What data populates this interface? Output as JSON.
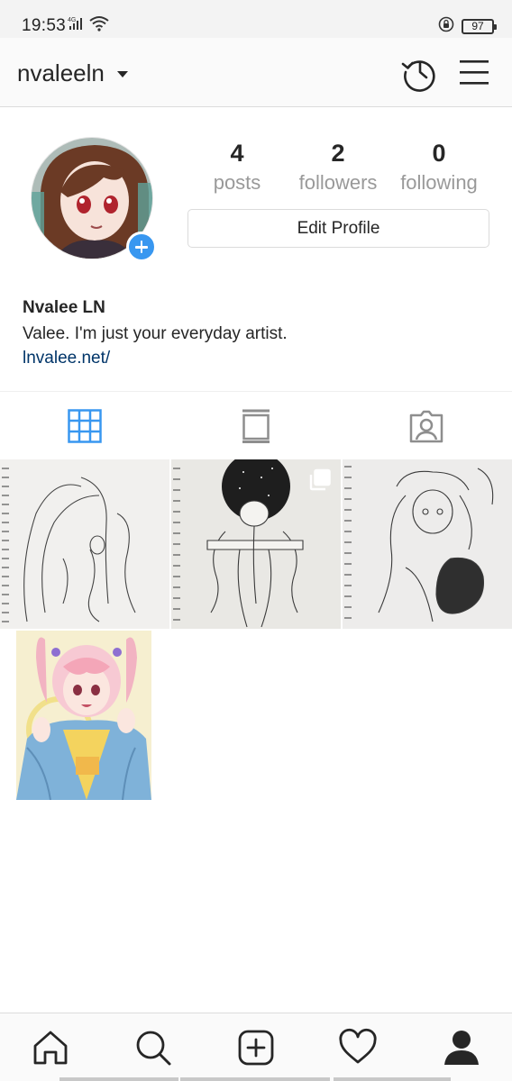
{
  "status_bar": {
    "time": "19:53",
    "network": "4G",
    "battery": "97"
  },
  "header": {
    "username": "nvaleeln",
    "icons": [
      "chevron-down-icon",
      "history-icon",
      "menu-icon"
    ]
  },
  "profile": {
    "stats": [
      {
        "value": "4",
        "label": "posts"
      },
      {
        "value": "2",
        "label": "followers"
      },
      {
        "value": "0",
        "label": "following"
      }
    ],
    "edit_button": "Edit Profile",
    "name": "Nvalee LN",
    "bio": "Valee. I'm just your everyday artist.",
    "link": "lnvalee.net/"
  },
  "tabs": [
    {
      "icon": "grid-icon",
      "active": true
    },
    {
      "icon": "feed-icon",
      "active": false
    },
    {
      "icon": "tagged-icon",
      "active": false
    }
  ],
  "posts": [
    {
      "type": "sketch",
      "multiple": false
    },
    {
      "type": "sketch",
      "multiple": true
    },
    {
      "type": "sketch",
      "multiple": false
    },
    {
      "type": "color-illustration",
      "multiple": false
    }
  ],
  "bottom_nav": [
    "home-icon",
    "search-icon",
    "new-post-icon",
    "activity-icon",
    "profile-icon"
  ],
  "colors": {
    "accent": "#3897f0",
    "link": "#003569",
    "text": "#262626",
    "muted": "#999999",
    "border": "#dbdbdb"
  }
}
